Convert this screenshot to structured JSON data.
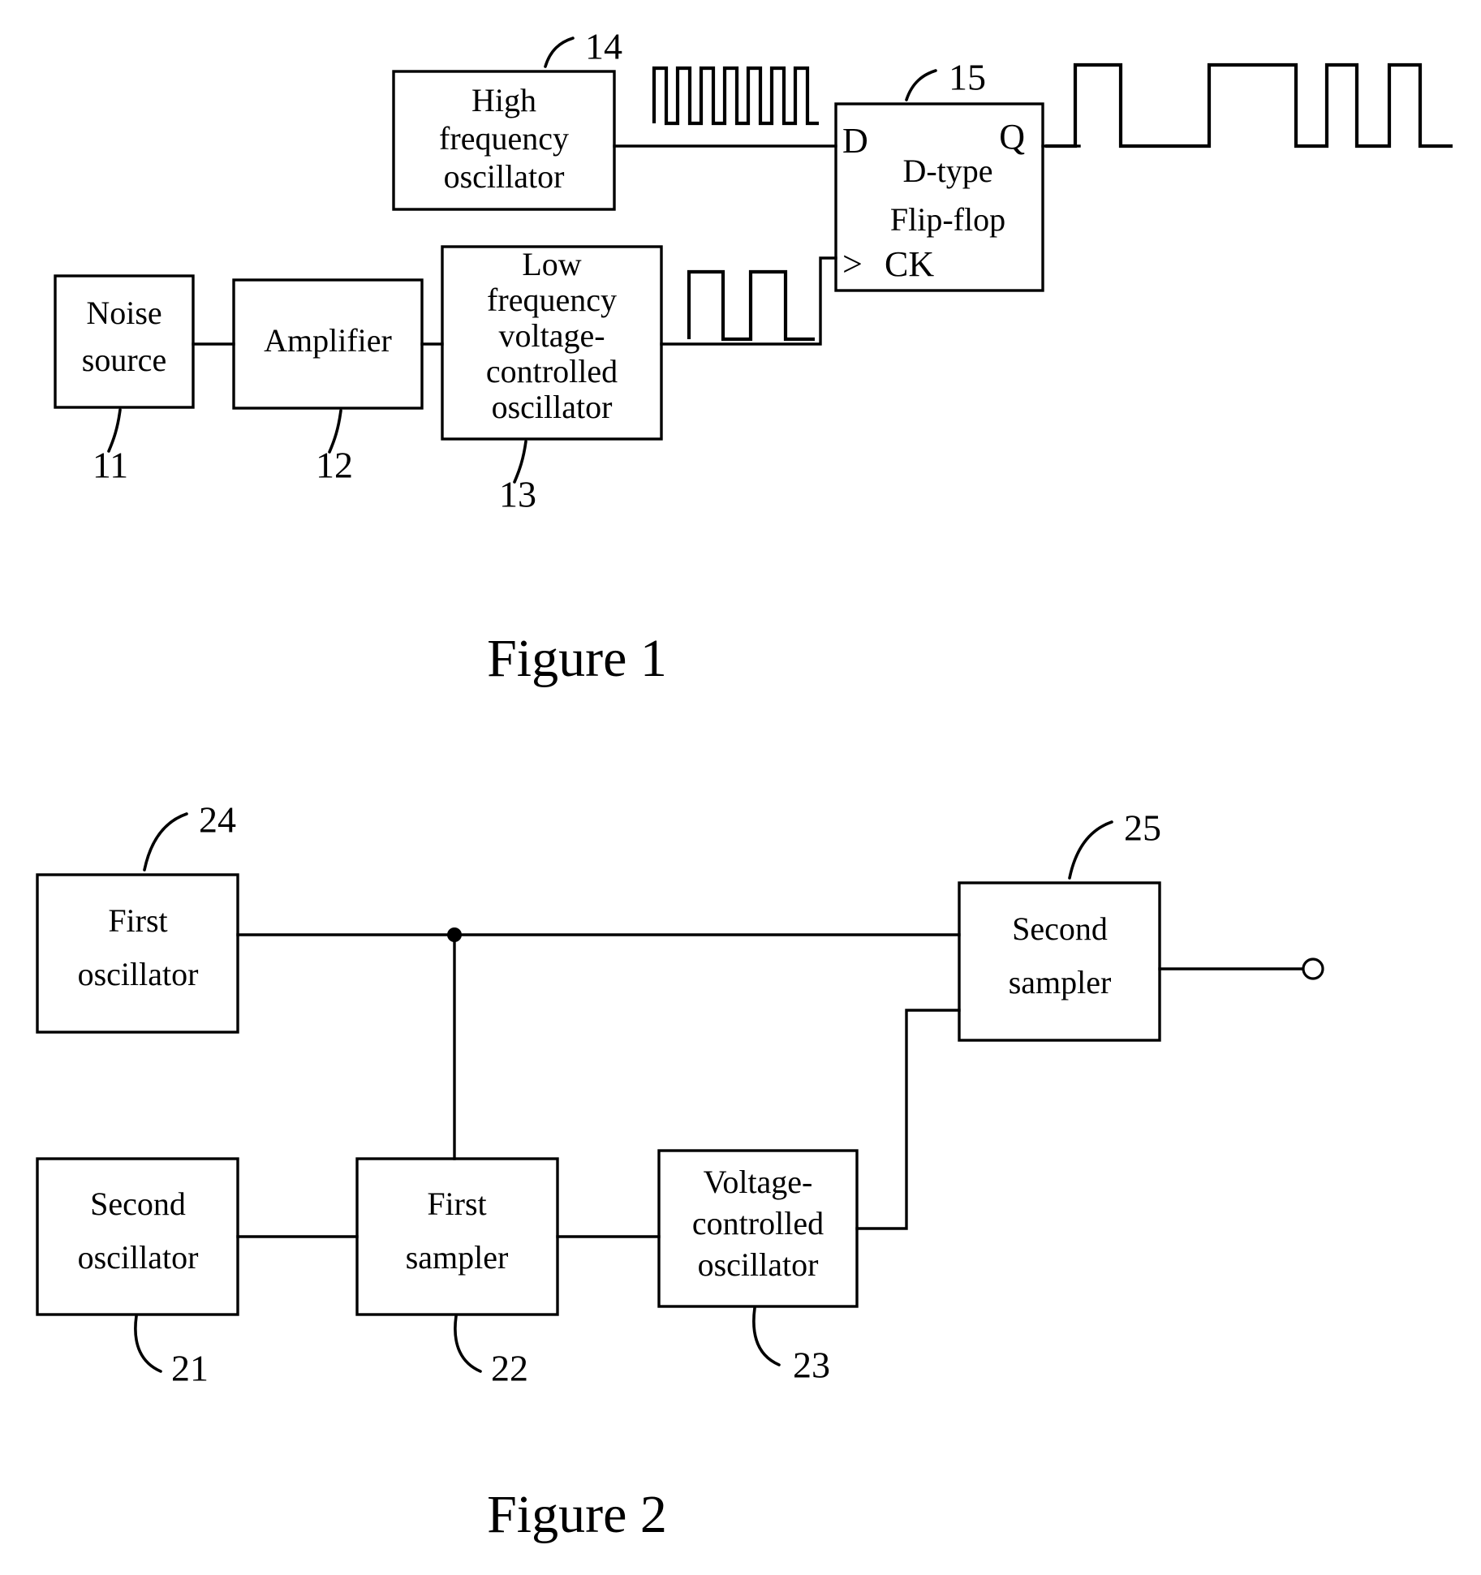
{
  "page": {
    "background": "#ffffff",
    "ink": "#000000",
    "kind": "patent-block-diagram-sheet"
  },
  "figure1": {
    "caption": "Figure 1",
    "blocks": [
      {
        "id": "b11",
        "ref": "11",
        "lines": [
          "Noise",
          "source"
        ]
      },
      {
        "id": "b12",
        "ref": "12",
        "lines": [
          "Amplifier"
        ]
      },
      {
        "id": "b13",
        "ref": "13",
        "lines": [
          "Low",
          "frequency",
          "voltage-",
          "controlled",
          "oscillator"
        ]
      },
      {
        "id": "b14",
        "ref": "14",
        "lines": [
          "High",
          "frequency",
          "oscillator"
        ]
      },
      {
        "id": "b15",
        "ref": "15",
        "lines": [
          "D-type",
          "Flip-flop"
        ]
      }
    ],
    "pins": {
      "d_input": "D",
      "q_output": "Q",
      "clock": "CK",
      "clock_marker": ">"
    },
    "waveforms": {
      "high_frequency": {
        "name": "high-frequency-pulse-train",
        "pulse_count": 8,
        "description": "dense narrow square pulse train"
      },
      "low_frequency": {
        "name": "low-frequency-pulse-train",
        "pulse_count": 2,
        "description": "two wide square pulses"
      },
      "output": {
        "name": "random-output-pulse-train",
        "pulse_count": 4,
        "description": "irregular random-width square pulses"
      }
    }
  },
  "figure2": {
    "caption": "Figure 2",
    "blocks": [
      {
        "id": "b21",
        "ref": "21",
        "lines": [
          "Second",
          "oscillator"
        ]
      },
      {
        "id": "b22",
        "ref": "22",
        "lines": [
          "First",
          "sampler"
        ]
      },
      {
        "id": "b23",
        "ref": "23",
        "lines": [
          "Voltage-",
          "controlled",
          "oscillator"
        ]
      },
      {
        "id": "b24",
        "ref": "24",
        "lines": [
          "First",
          "oscillator"
        ]
      },
      {
        "id": "b25",
        "ref": "25",
        "lines": [
          "Second",
          "sampler"
        ]
      }
    ],
    "junction": {
      "name": "wire-junction-dot"
    },
    "output_terminal": {
      "name": "output-terminal-circle"
    }
  }
}
